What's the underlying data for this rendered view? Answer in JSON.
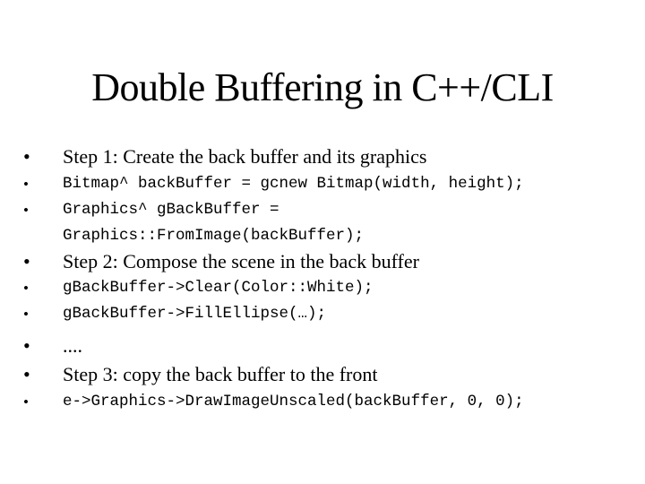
{
  "slide": {
    "title": "Double Buffering in C++/CLI",
    "bullet_glyph": "•",
    "items": [
      {
        "style": "text",
        "text": "Step 1: Create the back buffer and its graphics"
      },
      {
        "style": "code",
        "text": "Bitmap^ backBuffer = gcnew Bitmap(width, height);"
      },
      {
        "style": "code",
        "text": "Graphics^ gBackBuffer =\nGraphics::FromImage(backBuffer);"
      },
      {
        "style": "text",
        "text": "Step 2: Compose the scene in the back buffer"
      },
      {
        "style": "code",
        "text": "gBackBuffer->Clear(Color::White);"
      },
      {
        "style": "code",
        "text": "gBackBuffer->FillEllipse(…);"
      },
      {
        "style": "text",
        "text": "...."
      },
      {
        "style": "text",
        "text": "Step 3: copy the back buffer to the front"
      },
      {
        "style": "code",
        "text": "e->Graphics->DrawImageUnscaled(backBuffer, 0, 0);"
      }
    ]
  }
}
